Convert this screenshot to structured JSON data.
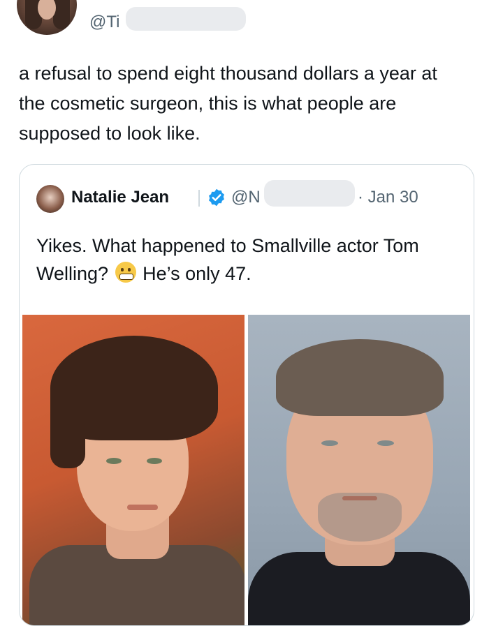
{
  "tweet": {
    "handle": "@Ti",
    "text": "a refusal to spend eight thousand dollars a year at the cosmetic surgeon, this is what people are supposed to look like."
  },
  "quoted_tweet": {
    "author_name": "Natalie Jean",
    "handle": "@N",
    "date": "· Jan 30",
    "text_before_emoji": "Yikes. What happened to Smallville actor Tom Welling?",
    "emoji": "grimacing-face-emoji",
    "text_after_emoji": "He’s only 47.",
    "verified_color": "#1d9bf0"
  }
}
